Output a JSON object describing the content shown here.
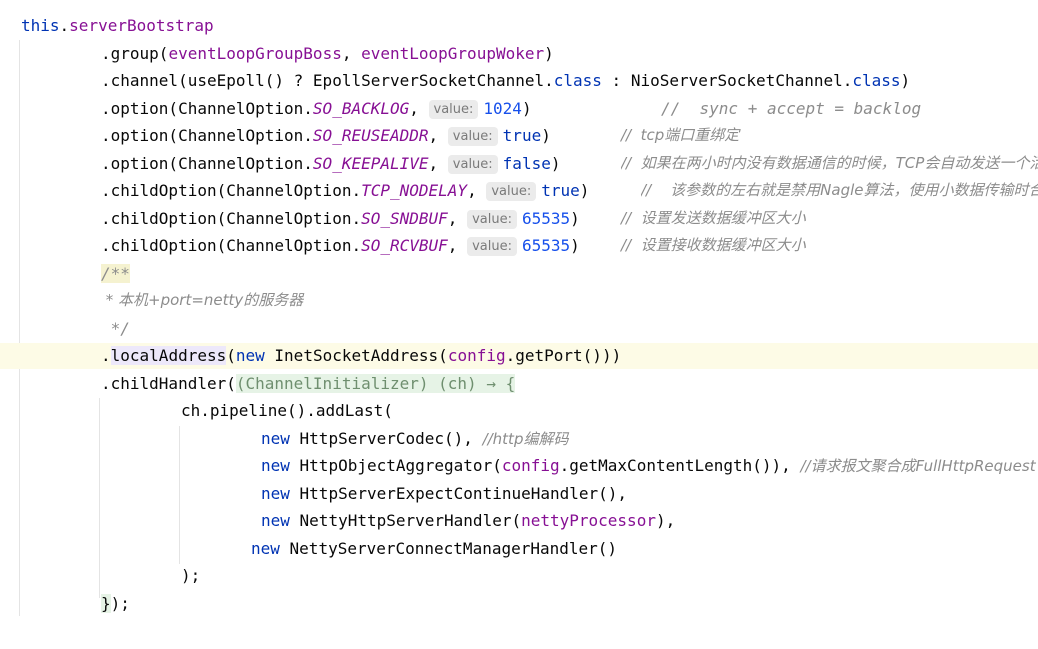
{
  "code": {
    "l01": {
      "a": "this",
      "b": ".",
      "c": "serverBootstrap"
    },
    "l02": {
      "a": ".group(",
      "b": "eventLoopGroupBoss",
      "c": ", ",
      "d": "eventLoopGroupWoker",
      "e": ")"
    },
    "l03": {
      "a": ".channel(useEpoll() ? EpollServerSocketChannel.",
      "b": "class",
      "c": " : NioServerSocketChannel.",
      "d": "class",
      "e": ")"
    },
    "l04": {
      "a": ".option(ChannelOption.",
      "b": "SO_BACKLOG",
      "c": ", ",
      "hint": "value:",
      "d": "1024",
      "e": ")",
      "cmt": "//  sync + accept = backlog"
    },
    "l05": {
      "a": ".option(ChannelOption.",
      "b": "SO_REUSEADDR",
      "c": ", ",
      "hint": "value:",
      "d": "true",
      "e": ")",
      "cmt": "//  tcp端口重绑定"
    },
    "l06": {
      "a": ".option(ChannelOption.",
      "b": "SO_KEEPALIVE",
      "c": ", ",
      "hint": "value:",
      "d": "false",
      "e": ")",
      "cmt": "//  如果在两小时内没有数据通信的时候，TCP会自动发送一个活动探测数据报文"
    },
    "l07": {
      "a": ".childOption(ChannelOption.",
      "b": "TCP_NODELAY",
      "c": ", ",
      "hint": "value:",
      "d": "true",
      "e": ")",
      "cmt": "//    该参数的左右就是禁用Nagle算法，使用小数据传输时合并"
    },
    "l08": {
      "a": ".childOption(ChannelOption.",
      "b": "SO_SNDBUF",
      "c": ", ",
      "hint": "value:",
      "d": "65535",
      "e": ")",
      "cmt": "//  设置发送数据缓冲区大小"
    },
    "l09": {
      "a": ".childOption(ChannelOption.",
      "b": "SO_RCVBUF",
      "c": ", ",
      "hint": "value:",
      "d": "65535",
      "e": ")",
      "cmt": "//  设置接收数据缓冲区大小"
    },
    "l10": {
      "a": "/**"
    },
    "l11": {
      "a": " * 本机+port=netty的服务器"
    },
    "l12": {
      "a": " */"
    },
    "l13": {
      "a": ".",
      "b": "localAddress",
      "c": "(",
      "d": "new",
      "e": " InetSocketAddress(",
      "f": "config",
      "g": ".getPort()))"
    },
    "l14": {
      "a": ".childHandler(",
      "b": "(ChannelInitializer) (ch) → {"
    },
    "l15": {
      "a": "ch.pipeline().addLast("
    },
    "l16": {
      "a": "new",
      "b": " HttpServerCodec(), ",
      "cmt": "//http编解码"
    },
    "l17": {
      "a": "new",
      "b": " HttpObjectAggregator(",
      "c": "config",
      "d": ".getMaxContentLength()), ",
      "cmt": "//请求报文聚合成FullHttpRequest"
    },
    "l18": {
      "a": "new",
      "b": " HttpServerExpectContinueHandler(),"
    },
    "l19": {
      "a": "new",
      "b": " NettyHttpServerHandler(",
      "c": "nettyProcessor",
      "d": "),"
    },
    "l20": {
      "a": "new",
      "b": " NettyServerConnectManagerHandler()"
    },
    "l21": {
      "a": ");"
    },
    "l22": {
      "a": "}",
      "b": ");"
    }
  }
}
